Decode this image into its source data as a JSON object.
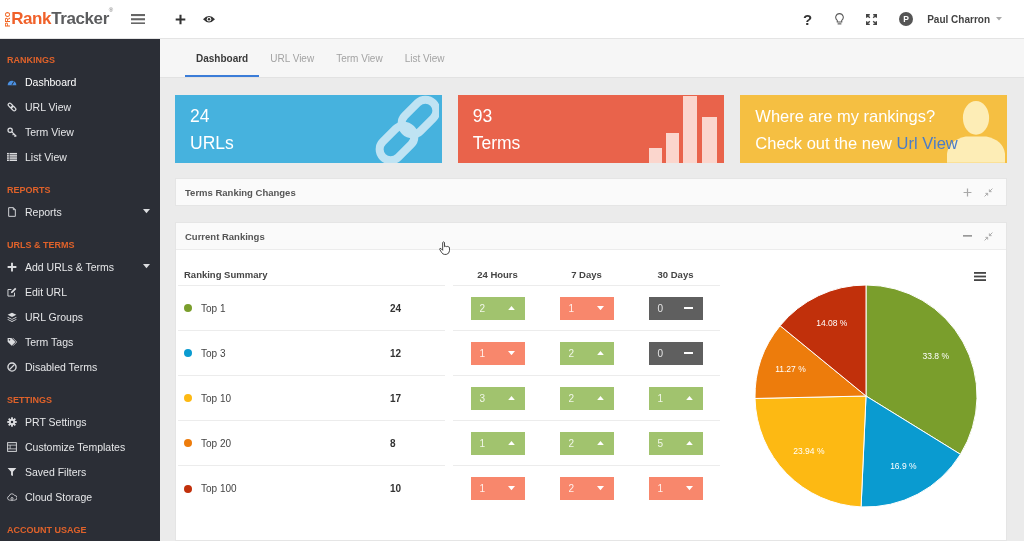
{
  "logo": {
    "badge": "PRO",
    "name_start": "Rank",
    "name_end": "Tracker",
    "mark": "®"
  },
  "topbar": {
    "help": "?",
    "user": {
      "initial": "P",
      "name": "Paul Charron"
    }
  },
  "sidebar": {
    "sections": [
      {
        "title": "RANKINGS",
        "items": [
          {
            "label": "Dashboard",
            "selected": true,
            "has_submenu": false
          },
          {
            "label": "URL View",
            "selected": false,
            "has_submenu": false
          },
          {
            "label": "Term View",
            "selected": false,
            "has_submenu": false
          },
          {
            "label": "List View",
            "selected": false,
            "has_submenu": false
          }
        ]
      },
      {
        "title": "REPORTS",
        "items": [
          {
            "label": "Reports",
            "selected": false,
            "has_submenu": true
          }
        ]
      },
      {
        "title": "URLS & TERMS",
        "items": [
          {
            "label": "Add URLs & Terms",
            "selected": false,
            "has_submenu": true
          },
          {
            "label": "Edit URL",
            "selected": false,
            "has_submenu": false
          },
          {
            "label": "URL Groups",
            "selected": false,
            "has_submenu": false
          },
          {
            "label": "Term Tags",
            "selected": false,
            "has_submenu": false
          },
          {
            "label": "Disabled Terms",
            "selected": false,
            "has_submenu": false
          }
        ]
      },
      {
        "title": "SETTINGS",
        "items": [
          {
            "label": "PRT Settings",
            "selected": false,
            "has_submenu": false
          },
          {
            "label": "Customize Templates",
            "selected": false,
            "has_submenu": false
          },
          {
            "label": "Saved Filters",
            "selected": false,
            "has_submenu": false
          },
          {
            "label": "Cloud Storage",
            "selected": false,
            "has_submenu": false
          }
        ]
      },
      {
        "title": "ACCOUNT USAGE"
      }
    ]
  },
  "tabs": [
    {
      "label": "Dashboard",
      "selected": true
    },
    {
      "label": "URL View",
      "selected": false
    },
    {
      "label": "Term View",
      "selected": false
    },
    {
      "label": "List View",
      "selected": false
    }
  ],
  "cards": [
    {
      "kind": "urls",
      "count": "24",
      "label": "URLs"
    },
    {
      "kind": "terms",
      "count": "93",
      "label": "Terms"
    },
    {
      "kind": "promo",
      "line_1": "Where are my rankings?",
      "line_2": "Check out the new",
      "link": "Url View"
    }
  ],
  "panels": [
    {
      "title": "Terms Ranking Changes",
      "expanded": false
    },
    {
      "title": "Current Rankings",
      "expanded": true,
      "table": {
        "columns": [
          "Ranking Summary",
          "24 Hours",
          "7 Days",
          "30 Days"
        ],
        "rows": [
          {
            "name": "Top 1",
            "color": "#7a9e2c",
            "count": "24",
            "changes": [
              {
                "value": "2",
                "kind": "up"
              },
              {
                "value": "1",
                "kind": "down"
              },
              {
                "value": "0",
                "kind": "flat"
              }
            ]
          },
          {
            "name": "Top 3",
            "color": "#0a9bd0",
            "count": "12",
            "changes": [
              {
                "value": "1",
                "kind": "down"
              },
              {
                "value": "2",
                "kind": "up"
              },
              {
                "value": "0",
                "kind": "flat"
              }
            ]
          },
          {
            "name": "Top 10",
            "color": "#fdb913",
            "count": "17",
            "changes": [
              {
                "value": "3",
                "kind": "up"
              },
              {
                "value": "2",
                "kind": "up"
              },
              {
                "value": "1",
                "kind": "up"
              }
            ]
          },
          {
            "name": "Top 20",
            "color": "#ed7c0c",
            "count": "8",
            "changes": [
              {
                "value": "1",
                "kind": "up"
              },
              {
                "value": "2",
                "kind": "up"
              },
              {
                "value": "5",
                "kind": "up"
              }
            ]
          },
          {
            "name": "Top 100",
            "color": "#c1300b",
            "count": "10",
            "changes": [
              {
                "value": "1",
                "kind": "down"
              },
              {
                "value": "2",
                "kind": "down"
              },
              {
                "value": "1",
                "kind": "down"
              }
            ]
          }
        ]
      },
      "chart_data": {
        "type": "pie",
        "values": [
          33.8,
          16.9,
          23.94,
          11.27,
          14.08
        ],
        "value_labels": [
          "33.8 %",
          "16.9 %",
          "23.94 %",
          "11.27 %",
          "14.08 %"
        ]
      }
    }
  ]
}
